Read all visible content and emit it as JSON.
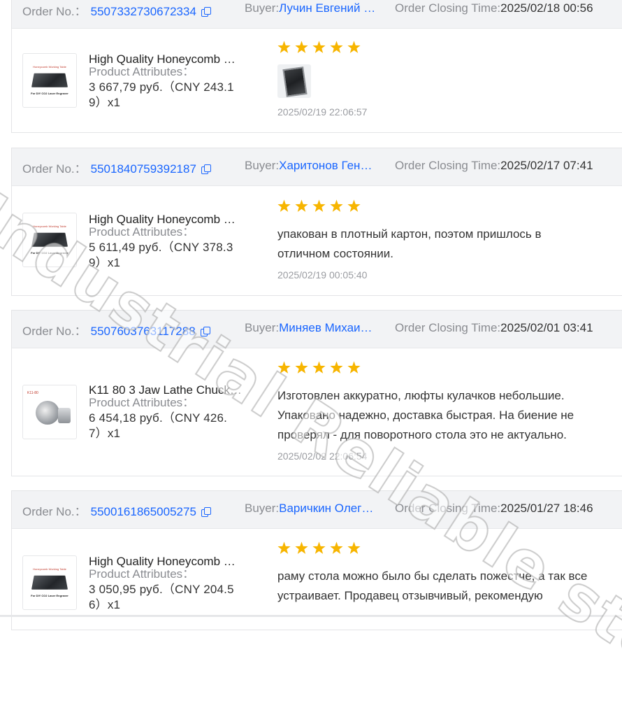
{
  "labels": {
    "order_no": "Order No.：",
    "buyer": "Buyer:",
    "closing_time": "Order Closing Time:",
    "product_attributes": "Product Attributes："
  },
  "orders": [
    {
      "order_no": "5507332730672334",
      "buyer": "Лучин Евгений …",
      "closing_time": "2025/02/18 00:56",
      "product_title": "High Quality Honeycomb …",
      "price_line1": "3 667,79 руб.（CNY  243.1",
      "price_line2": "9）x1",
      "thumb_title": "Honeycomb Working Table",
      "thumb_sub": "For DIY CO2 Laser Engraver",
      "rating": 5,
      "review_text": "",
      "has_photo": true,
      "review_date": "2025/02/19 22:06:57"
    },
    {
      "order_no": "5501840759392187",
      "buyer": "Харитонов Ген…",
      "closing_time": "2025/02/17 07:41",
      "product_title": "High Quality Honeycomb …",
      "price_line1": "5 611,49 руб.（CNY  378.3",
      "price_line2": "9）x1",
      "thumb_title": "Honeycomb Working Table",
      "thumb_sub": "For DIY CO2 Laser Engraver",
      "rating": 5,
      "review_text": "упакован в плотный картон, поэтом пришлось в отличном состоянии.",
      "has_photo": false,
      "review_date": "2025/02/19 00:05:40"
    },
    {
      "order_no": "5507603763117288",
      "buyer": "Миняев Михаи…",
      "closing_time": "2025/02/01 03:41",
      "product_title": "K11 80 3 Jaw Lathe Chuck…",
      "price_line1": "6 454,18 руб.（CNY  426.",
      "price_line2": "7）x1",
      "thumb_title": "K11-80",
      "thumb_sub": "",
      "rating": 5,
      "review_text": "Изготовлен аккуратно, люфты кулачков небольшие. Упаковано надежно, доставка быстрая. На биение не проверял - для поворотного стола это не актуально.",
      "has_photo": false,
      "review_date": "2025/02/02 22:06:54"
    },
    {
      "order_no": "5500161865005275",
      "buyer": "Варичкин Олег…",
      "closing_time": "2025/01/27 18:46",
      "product_title": "High Quality Honeycomb …",
      "price_line1": "3 050,95 руб.（CNY  204.5",
      "price_line2": "6）x1",
      "thumb_title": "Honeycomb Working Table",
      "thumb_sub": "For DIY CO2 Laser Engraver",
      "rating": 5,
      "review_text": "раму стола можно было бы сделать пожестче, а так все устраивает. Продавец отзывчивый, рекомендую",
      "has_photo": false,
      "review_date": ""
    }
  ],
  "watermark": "Industrial Reliable store",
  "colors": {
    "link": "#1a66ff",
    "star": "#f7b500",
    "header_bg": "#f2f3f5"
  }
}
